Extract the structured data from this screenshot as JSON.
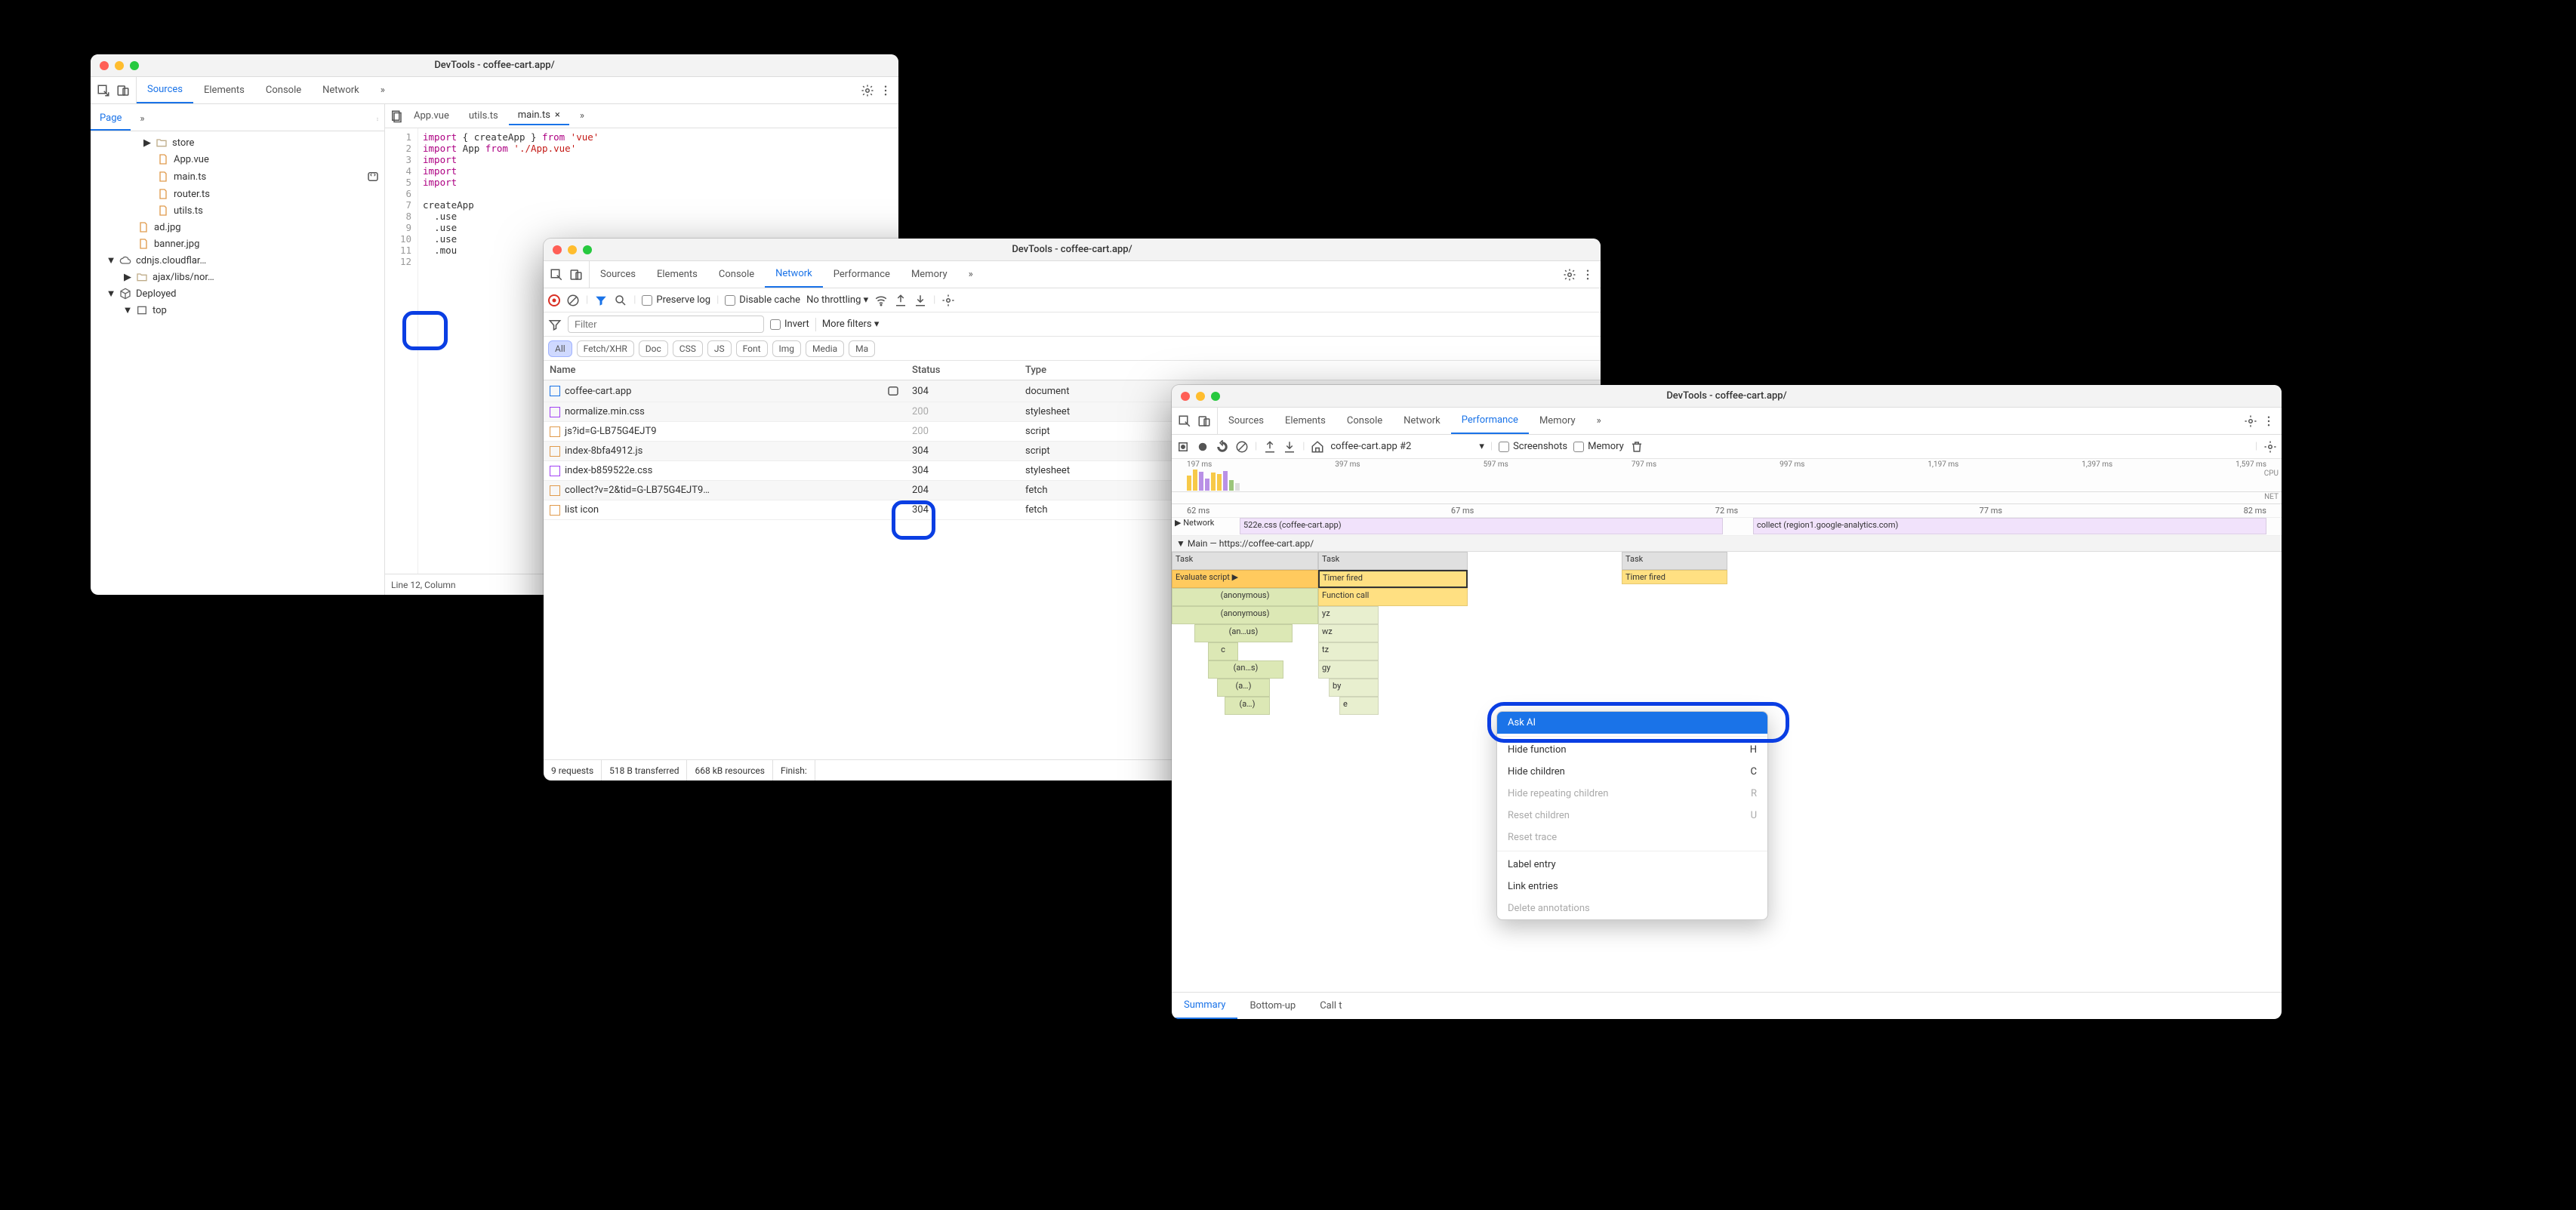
{
  "window1": {
    "title": "DevTools - coffee-cart.app/",
    "panels": [
      "Sources",
      "Elements",
      "Console",
      "Network"
    ],
    "activePanel": "Sources",
    "sidebarTab": "Page",
    "tree": {
      "store": "store",
      "appvue": "App.vue",
      "maints": "main.ts",
      "routerts": "router.ts",
      "utilts": "utils.ts",
      "adjpg": "ad.jpg",
      "bannerjpg": "banner.jpg",
      "cdnjs": "cdnjs.cloudflar…",
      "ajax": "ajax/libs/nor…",
      "deployed": "Deployed",
      "top": "top"
    },
    "editorTabs": {
      "appvue": "App.vue",
      "utilts": "utils.ts",
      "maints": "main.ts"
    },
    "activeEditorTab": "main.ts",
    "code": {
      "1": {
        "kw": "import",
        "body": " { createApp } ",
        "kw2": "from",
        "str": " 'vue'"
      },
      "2": {
        "kw": "import",
        "body": " App ",
        "kw2": "from",
        "str": " './App.vue'"
      },
      "3": {
        "kw": "import"
      },
      "4": {
        "kw": "import"
      },
      "5": {
        "kw": "import"
      },
      "7": {
        "fn": "createApp"
      },
      "8": ".use",
      "9": ".use",
      "10": ".use",
      "11": ".mou"
    },
    "statusbar": "Line 12, Column"
  },
  "window2": {
    "title": "DevTools - coffee-cart.app/",
    "panels": [
      "Sources",
      "Elements",
      "Console",
      "Network",
      "Performance",
      "Memory"
    ],
    "activePanel": "Network",
    "toolbar": {
      "preserve": "Preserve log",
      "disable": "Disable cache",
      "throttle": "No throttling",
      "filter": "Filter",
      "invert": "Invert",
      "more": "More filters"
    },
    "pills": [
      "All",
      "Fetch/XHR",
      "Doc",
      "CSS",
      "JS",
      "Font",
      "Img",
      "Media",
      "Ma"
    ],
    "cols": {
      "name": "Name",
      "status": "Status",
      "type": "Type"
    },
    "rows": [
      {
        "name": "coffee-cart.app",
        "status": "304",
        "type": "document",
        "icon": "doc",
        "sel": true
      },
      {
        "name": "normalize.min.css",
        "status": "200",
        "type": "stylesheet",
        "icon": "css"
      },
      {
        "name": "js?id=G-LB75G4EJT9",
        "status": "200",
        "type": "script",
        "icon": "js"
      },
      {
        "name": "index-8bfa4912.js",
        "status": "304",
        "type": "script",
        "icon": "js"
      },
      {
        "name": "index-b859522e.css",
        "status": "304",
        "type": "stylesheet",
        "icon": "css"
      },
      {
        "name": "collect?v=2&tid=G-LB75G4EJT9…",
        "status": "204",
        "type": "fetch",
        "icon": "fetch"
      },
      {
        "name": "list icon",
        "status": "304",
        "type": "fetch",
        "icon": "fetch"
      }
    ],
    "status": {
      "requests": "9 requests",
      "transfer": "518 B transferred",
      "resources": "668 kB resources",
      "finish": "Finish:"
    }
  },
  "window3": {
    "title": "DevTools - coffee-cart.app/",
    "panels": [
      "Sources",
      "Elements",
      "Console",
      "Network",
      "Performance",
      "Memory"
    ],
    "activePanel": "Performance",
    "toolbar": {
      "recording": "coffee-cart.app #2",
      "screenshots": "Screenshots",
      "memory": "Memory"
    },
    "overviewTicks": [
      "197 ms",
      "397 ms",
      "597 ms",
      "797 ms",
      "997 ms",
      "1,197 ms",
      "1,397 ms",
      "1,597 ms"
    ],
    "overviewLabels": {
      "cpu": "CPU",
      "net": "NET"
    },
    "ruler": [
      "62 ms",
      "67 ms",
      "72 ms",
      "77 ms",
      "82 ms"
    ],
    "lanes": {
      "network": "Network",
      "net1": "522e.css (coffee-cart.app)",
      "net2": "collect (region1.google-analytics.com)",
      "main": "Main — https://coffee-cart.app/"
    },
    "flame": {
      "task": "Task",
      "task2": "Task",
      "task3": "Task",
      "eval": "Evaluate script",
      "timer": "Timer fired",
      "timer2": "Timer fired",
      "fcall": "Function call",
      "anon": "(anonymous)",
      "anon2": "(anonymous)",
      "anus": "(an…us)",
      "c": "c",
      "ans": "(an…s)",
      "a": "(a…)",
      "a2": "(a…)",
      "yz": "yz",
      "wz": "wz",
      "tz": "tz",
      "gy": "gy",
      "by": "by",
      "e": "e"
    },
    "ctxmenu": {
      "ask": "Ask AI",
      "hideFn": "Hide function",
      "hideFnKey": "H",
      "hideCh": "Hide children",
      "hideChKey": "C",
      "hideRep": "Hide repeating children",
      "hideRepKey": "R",
      "reset": "Reset children",
      "resetKey": "U",
      "resetTr": "Reset trace",
      "label": "Label entry",
      "link": "Link entries",
      "del": "Delete annotations"
    },
    "bottomTabs": [
      "Summary",
      "Bottom-up",
      "Call t"
    ]
  }
}
